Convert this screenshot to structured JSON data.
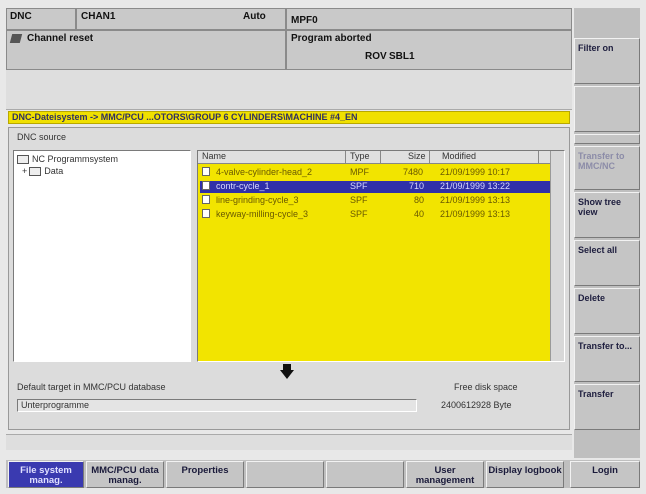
{
  "header": {
    "mode": "DNC",
    "channel": "CHAN1",
    "op_mode": "Auto",
    "program": "MPF0",
    "channel_status": "Channel reset",
    "program_status": "Program aborted",
    "indicator_rov": "ROV",
    "indicator_sbl": "SBL1"
  },
  "path_bar": "DNC-Dateisystem -> MMC/PCU  ...OTORS\\GROUP 6 CYLINDERS\\MACHINE #4_EN",
  "source": {
    "label": "DNC source",
    "tree": [
      {
        "label": "NC Programmsystem"
      },
      {
        "label": "Data"
      }
    ]
  },
  "file_table": {
    "columns": [
      "Name",
      "Type",
      "Size",
      "Modified"
    ],
    "rows": [
      {
        "name": "4-valve-cylinder-head_2",
        "type": "MPF",
        "size": "7480",
        "modified": "21/09/1999 10:17",
        "selected": false
      },
      {
        "name": "contr-cycle_1",
        "type": "SPF",
        "size": "710",
        "modified": "21/09/1999 13:22",
        "selected": true
      },
      {
        "name": "line-grinding-cycle_3",
        "type": "SPF",
        "size": "80",
        "modified": "21/09/1999 13:13",
        "selected": false
      },
      {
        "name": "keyway-milling-cycle_3",
        "type": "SPF",
        "size": "40",
        "modified": "21/09/1999 13:13",
        "selected": false
      }
    ]
  },
  "target": {
    "label": "Default target in MMC/PCU database",
    "value": "Unterprogramme",
    "free_label": "Free disk space",
    "free_value": "2400612928 Byte"
  },
  "vertical_softkeys": [
    {
      "label": "Filter on",
      "disabled": false
    },
    {
      "label": "",
      "disabled": false
    },
    {
      "label": "",
      "disabled": false
    },
    {
      "label": "Transfer to MMC/NC",
      "disabled": true
    },
    {
      "label": "Show tree view",
      "disabled": false
    },
    {
      "label": "Select all",
      "disabled": false
    },
    {
      "label": "Delete",
      "disabled": false
    },
    {
      "label": "Transfer to...",
      "disabled": false
    },
    {
      "label": "Transfer",
      "disabled": false
    }
  ],
  "horizontal_softkeys": [
    {
      "label": "File system manag.",
      "active": true
    },
    {
      "label": "MMC/PCU data manag.",
      "active": false
    },
    {
      "label": "Properties",
      "active": false
    },
    {
      "label": "",
      "active": false
    },
    {
      "label": "",
      "active": false
    },
    {
      "label": "User management",
      "active": false
    },
    {
      "label": "Display logbook",
      "active": false
    },
    {
      "label": "Login",
      "active": false
    }
  ]
}
